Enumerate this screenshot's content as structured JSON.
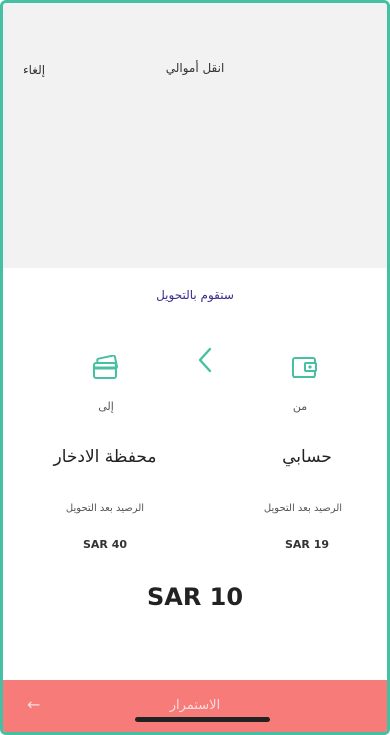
{
  "header": {
    "title": "انقل أموالي",
    "cancel_label": "إلغاء"
  },
  "transfer": {
    "heading": "ستقوم بالتحويل",
    "from": {
      "label": "من",
      "name": "حسابي",
      "balance_label": "الرصيد بعد التحويل",
      "balance": "SAR 19",
      "icon": "wallet-icon"
    },
    "to": {
      "label": "إلى",
      "name": "محفظة الادخار",
      "balance_label": "الرصيد بعد التحويل",
      "balance": "SAR 40",
      "icon": "card-icon"
    },
    "direction_icon": "chevron-left-icon",
    "amount": "SAR 10"
  },
  "footer": {
    "continue_label": "الاستمرار",
    "arrow_icon": "arrow-left-icon"
  },
  "colors": {
    "accent": "#45c0a2",
    "heading": "#3d2d8c",
    "cta": "#f77b78"
  }
}
